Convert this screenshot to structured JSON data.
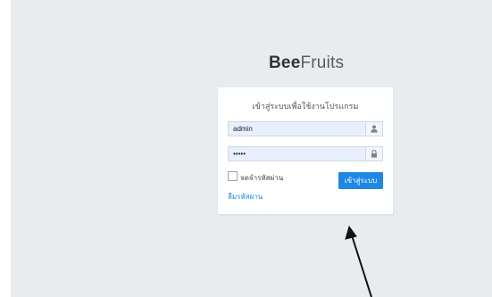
{
  "brand": {
    "bold": "Bee",
    "light": "Fruits"
  },
  "login": {
    "title": "เข้าสู่ระบบเพื่อใช้งานโปรแกรม",
    "username_value": "admin",
    "password_value": "•••••",
    "remember_label": "จดจำรหัสผ่าน",
    "submit_label": "เข้าสู่ระบบ",
    "forgot_label": "ลืมรหัสผ่าน"
  },
  "icons": {
    "user": "user-icon",
    "lock": "lock-icon",
    "annotation": "arrow-annotation"
  },
  "colors": {
    "accent": "#1e88e5",
    "page_bg": "#e9ecef",
    "input_bg": "#e8f0fe"
  }
}
